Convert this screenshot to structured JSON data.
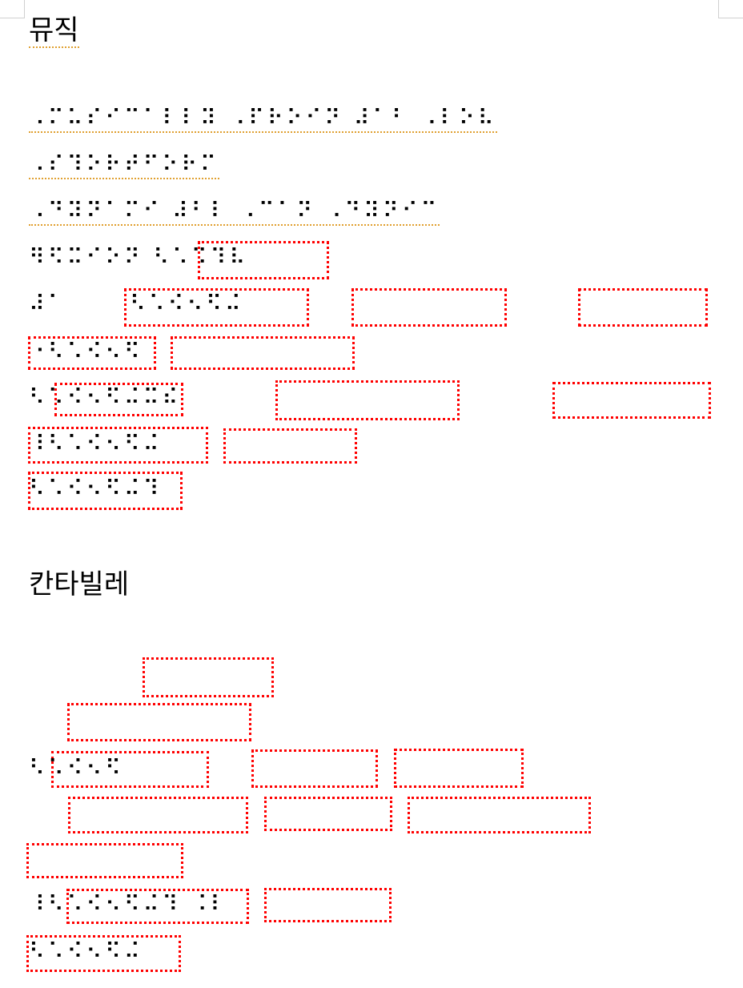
{
  "headings": {
    "music": "뮤직",
    "cantabile": "칸타빌레"
  },
  "braille_lines": [
    "⠠⠍⠥⠎⠊⠉⠁⠇⠇⠽ ⠠⠏⠗⠕⠊⠝ ⠼⠁⠃ ⠠⠇⠕⠧",
    "⠠⠎⠹⠕⠗⠞⠋⠕⠗⠍",
    "⠠⠙⠽⠝⠁⠍⠊ ⠼⠃⠇ ⠠⠉⠁⠝ ⠠⠙⠽⠝⠊⠉",
    "⠻⠫⠭⠊⠕⠝ ⠣⠡⠩⠹⠧",
    "⠼⠁",
    "⠣⠡⠪⠢⠫⠬",
    "⠐⠣⠡⠪⠢⠫",
    "⠣⠡⠪⠢⠫⠬⠭⠮",
    "⠸⠣⠡⠪⠢⠫⠬",
    "⠣⠡⠪⠢⠫⠬⠹",
    "⠣⠡⠪⠢⠫",
    "⠸⠣⠡⠪⠢⠫⠬⠹ ⠨⠇",
    "⠣⠡⠪⠢⠫⠬"
  ]
}
